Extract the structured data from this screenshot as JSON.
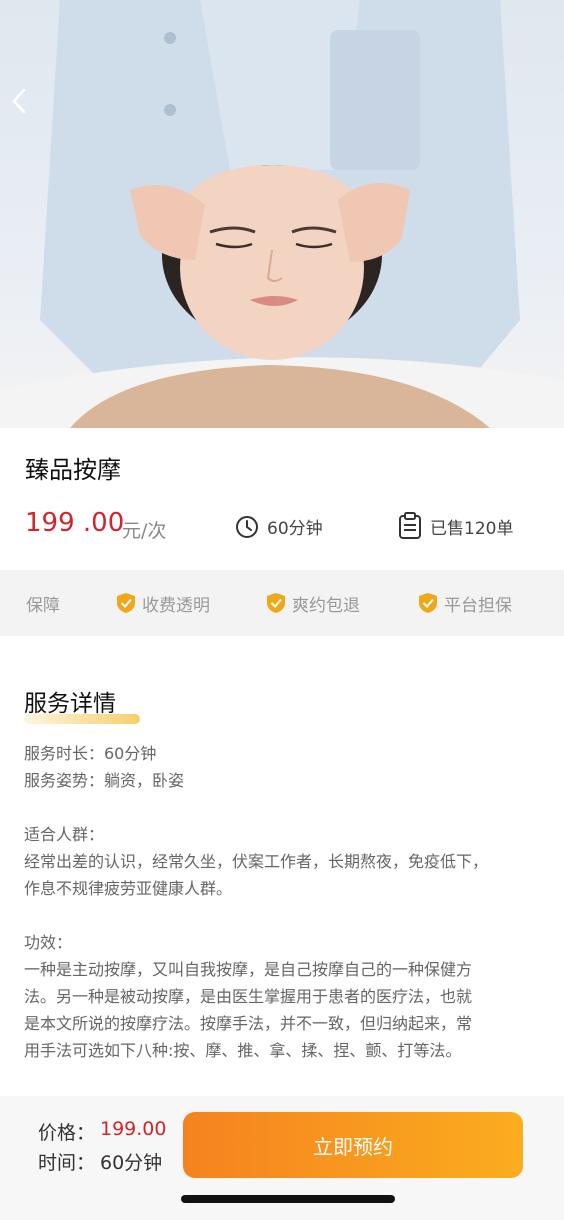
{
  "service": {
    "title": "臻品按摩",
    "price": "199 .00",
    "unit": "元/次",
    "duration": "60分钟",
    "sold": "已售120单"
  },
  "guarantee": {
    "label": "保障",
    "items": [
      "收费透明",
      "爽约包退",
      "平台担保"
    ]
  },
  "details": {
    "title": "服务详情",
    "duration_line": "服务时长：60分钟",
    "posture_line": "服务姿势：躺资，卧姿",
    "audience_title": "适合人群：",
    "audience_line1": "经常出差的认识，经常久坐，伏案工作者，长期熬夜，免疫低下，",
    "audience_line2": "作息不规律疲劳亚健康人群。",
    "effect_title": "功效：",
    "effect_line1": "一种是主动按摩，又叫自我按摩，是自己按摩自己的一种保健方",
    "effect_line2": "法。另一种是被动按摩，是由医生掌握用于患者的医疗法，也就",
    "effect_line3": "是本文所说的按摩疗法。按摩手法，并不一致，但归纳起来，常",
    "effect_line4": "用手法可选如下八种:按、摩、推、拿、揉、捏、颤、打等法。"
  },
  "bottom": {
    "price_label": "价格：",
    "price_value": "199.00",
    "time_label": "时间：",
    "time_value": "60分钟",
    "book_label": "立即预约"
  },
  "colors": {
    "price_red": "#d0252a",
    "accent_orange": "#f5821f",
    "badge_gold": "#f0a81a"
  },
  "icons": {
    "back": "chevron-left-icon",
    "clock": "clock-icon",
    "sold": "clipboard-icon",
    "guarantee": "shield-check-icon"
  }
}
